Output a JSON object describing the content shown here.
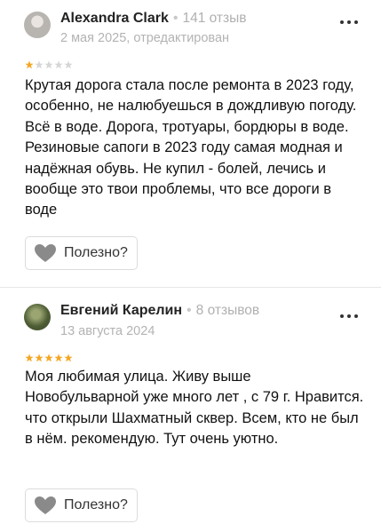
{
  "reviews": [
    {
      "author": "Alexandra Clark",
      "review_count": "141 отзыв",
      "date": "2 мая 2025, отредактирован",
      "rating": 1,
      "text": "Крутая дорога стала после ремонта в 2023 году, особенно, не налюбуешься в дождливую погоду. Всё в воде. Дорога, тротуары, бордюры в воде. Резиновые сапоги в 2023 году самая модная и надёжная обувь. Не купил - болей, лечись и вообще это твои проблемы, что все дороги в воде",
      "helpful_label": "Полезно?"
    },
    {
      "author": "Евгений Карелин",
      "review_count": "8 отзывов",
      "date": "13 августа 2024",
      "rating": 5,
      "text": "Моя любимая улица. Живу выше Новобульварной уже много лет , с 79 г. Нравится. что открыли Шахматный сквер. Всем, кто не был в нём. рекомендую. Тут очень уютно.",
      "helpful_label": "Полезно?"
    }
  ],
  "colors": {
    "star_filled": "#f5a623",
    "star_empty": "#d6d6d6",
    "heart": "#8a8a8a"
  },
  "icons": {
    "more": "more-dots-icon",
    "heart": "heart-icon",
    "star": "star-icon"
  }
}
